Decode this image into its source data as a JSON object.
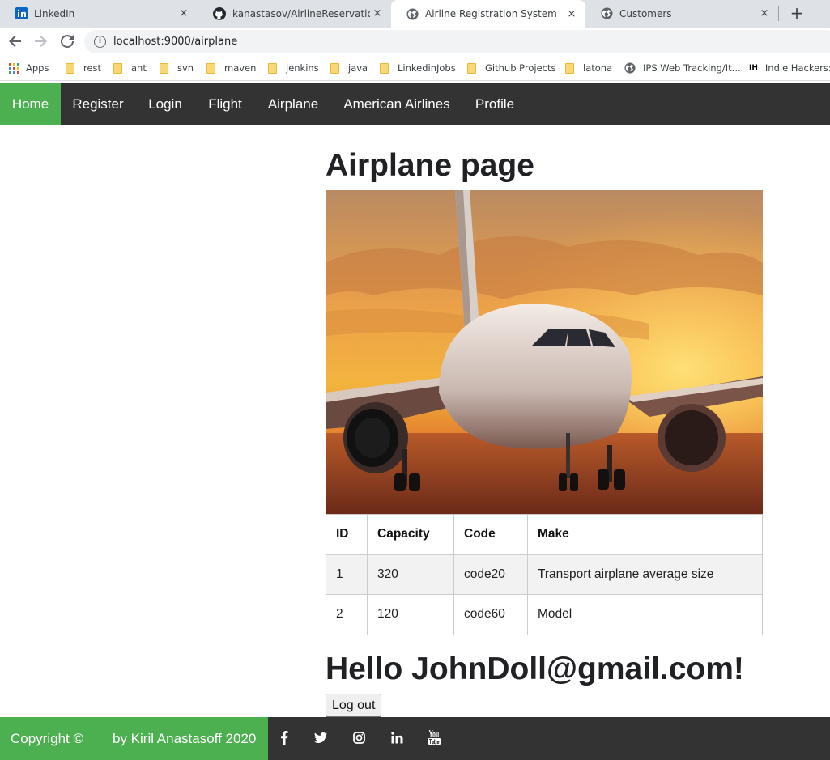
{
  "browser": {
    "tabs": [
      {
        "title": "LinkedIn",
        "icon": "linkedin-icon",
        "active": false
      },
      {
        "title": "kanastasov/AirlineReservationSys",
        "icon": "github-icon",
        "active": false
      },
      {
        "title": "Airline Registration System",
        "icon": "globe-icon",
        "active": true
      },
      {
        "title": "Customers",
        "icon": "globe-icon",
        "active": false
      }
    ],
    "close_glyph": "×",
    "new_tab_glyph": "+",
    "url": "localhost:9000/airplane",
    "bookmarks": [
      {
        "label": "Apps",
        "icon": "apps-grid-icon"
      },
      {
        "label": "rest",
        "icon": "folder-icon"
      },
      {
        "label": "ant",
        "icon": "folder-icon"
      },
      {
        "label": "svn",
        "icon": "folder-icon"
      },
      {
        "label": "maven",
        "icon": "folder-icon"
      },
      {
        "label": "jenkins",
        "icon": "folder-icon"
      },
      {
        "label": "java",
        "icon": "folder-icon"
      },
      {
        "label": "LinkedinJobs",
        "icon": "folder-icon"
      },
      {
        "label": "Github Projects",
        "icon": "folder-icon"
      },
      {
        "label": "latona",
        "icon": "folder-icon"
      },
      {
        "label": "IPS Web Tracking/It...",
        "icon": "globe-icon"
      },
      {
        "label": "Indie Hackers:",
        "icon": "ih-icon"
      }
    ]
  },
  "nav": {
    "items": [
      "Home",
      "Register",
      "Login",
      "Flight",
      "Airplane",
      "American Airlines",
      "Profile"
    ],
    "active": "Home",
    "active_color": "#4caf50",
    "bar_color": "#333333"
  },
  "main": {
    "title": "Airplane page",
    "table": {
      "headers": [
        "ID",
        "Capacity",
        "Code",
        "Make"
      ],
      "rows": [
        [
          "1",
          "320",
          "code20",
          "Transport airplane average size"
        ],
        [
          "2",
          "120",
          "code60",
          "Model"
        ]
      ]
    },
    "greeting": "Hello JohnDoll@gmail.com!",
    "logout_label": "Log out"
  },
  "footer": {
    "copyright": "Copyright ©",
    "author": "by Kiril Anastasoff 2020",
    "social_icons": [
      "facebook-icon",
      "twitter-icon",
      "instagram-icon",
      "linkedin-icon",
      "youtube-icon"
    ]
  }
}
